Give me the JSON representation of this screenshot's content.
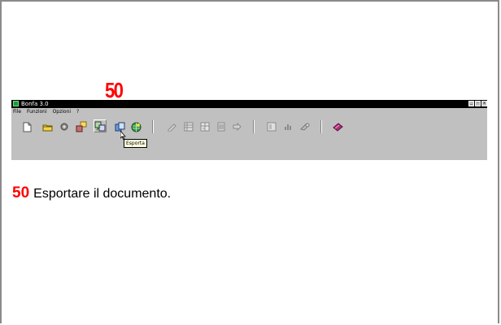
{
  "step_number": "50",
  "app": {
    "title": "Bonfa 3.0",
    "menus": [
      "File",
      "Funzioni",
      "Opzioni",
      "?"
    ],
    "window_buttons": [
      "_",
      "▫",
      "x"
    ]
  },
  "toolbar": {
    "tooltip": "Esporta",
    "icons": [
      "new-document-icon",
      "open-folder-icon",
      "record-icon",
      "import-icon",
      "export-icon",
      "copy-icon",
      "globe-icon",
      "pencil-icon",
      "grid-icon",
      "table-icon",
      "list-icon",
      "arrow-icon",
      "layout-icon",
      "chart-icon",
      "tools-icon",
      "book-icon"
    ]
  },
  "caption": {
    "number": "50",
    "text": "Esportare il documento."
  },
  "colors": {
    "accent": "#ff0000",
    "window_bg": "#c0c0c0",
    "titlebar": "#000000"
  }
}
